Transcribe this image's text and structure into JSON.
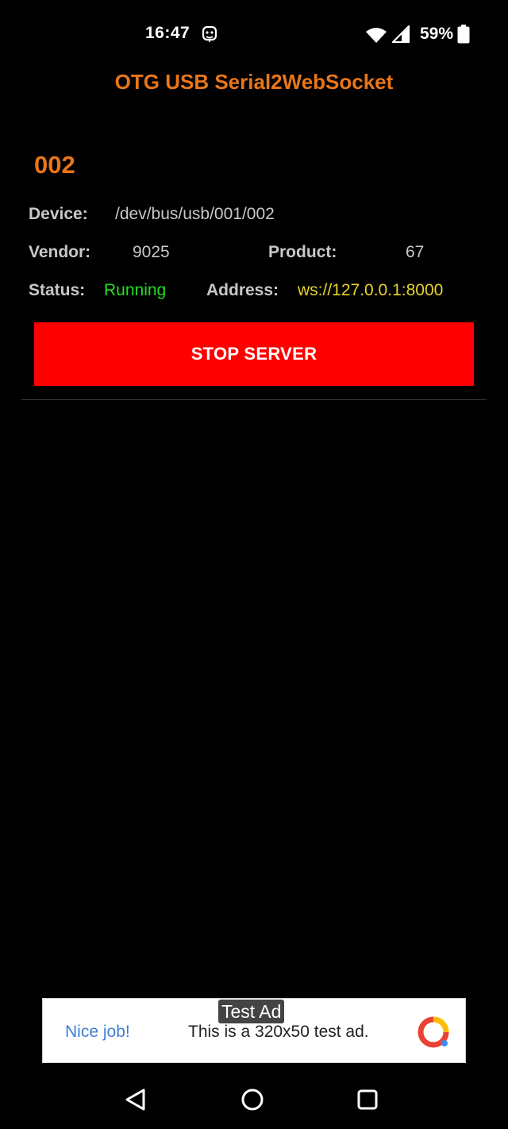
{
  "status_bar": {
    "time": "16:47",
    "battery_percent": "59%",
    "icons": [
      "notification-icon",
      "wifi-icon",
      "signal-icon",
      "battery-icon"
    ]
  },
  "app": {
    "title": "OTG USB Serial2WebSocket"
  },
  "device": {
    "name": "002",
    "device_label": "Device:",
    "device_value": "/dev/bus/usb/001/002",
    "vendor_label": "Vendor:",
    "vendor_value": "9025",
    "product_label": "Product:",
    "product_value": "67",
    "status_label": "Status:",
    "status_value": "Running",
    "address_label": "Address:",
    "address_value": "ws://127.0.0.1:8000"
  },
  "actions": {
    "stop_server_label": "STOP SERVER"
  },
  "ad": {
    "badge": "Test Ad",
    "nice_job": "Nice job!",
    "text": "This is a 320x50 test ad."
  },
  "nav_bar": {
    "icons": [
      "back-icon",
      "home-icon",
      "recents-icon"
    ]
  },
  "colors": {
    "accent": "#e8761a",
    "running": "#22dd22",
    "address": "#e6d22a",
    "stop_button": "#ff0000",
    "background": "#000000"
  }
}
